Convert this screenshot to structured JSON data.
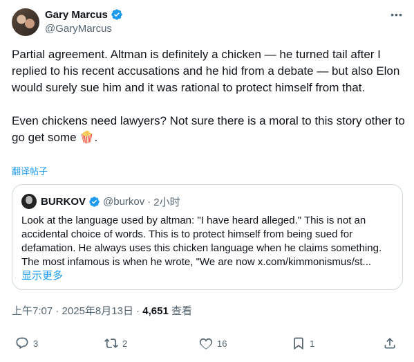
{
  "author": {
    "name": "Gary Marcus",
    "handle": "@GaryMarcus"
  },
  "tweet": {
    "text": "Partial agreement. Altman is definitely a chicken — he turned tail after I replied to his recent accusations and he hid from a debate — but also Elon would surely sue him and it was rational to protect himself from that.\n\nEven chickens need lawyers? Not sure there is a moral to this story other to go get some 🍿.",
    "translate_label": "翻译帖子"
  },
  "quote": {
    "name": "BURKOV",
    "handle": "@burkov",
    "separator": "·",
    "time": "2小时",
    "text": "Look at the language used by altman: \"I have heard alleged.\" This is not an accidental choice of words. This is to protect himself from being sued for defamation. He always uses this chicken language when he claims something. The most infamous is when he wrote, \"We are now x.com/kimmonismus/st...",
    "show_more": "显示更多"
  },
  "meta": {
    "time": "上午7:07",
    "separator": "·",
    "date": "2025年8月13日",
    "views_count": "4,651",
    "views_label": "查看"
  },
  "actions": {
    "replies": "3",
    "reposts": "2",
    "likes": "16",
    "bookmarks": "1"
  },
  "colors": {
    "accent": "#1d9bf0",
    "text": "#0f1419",
    "muted": "#536471",
    "border": "#cfd9de"
  },
  "icons": [
    "verified-badge-icon",
    "more-icon",
    "reply-icon",
    "repost-icon",
    "like-icon",
    "bookmark-icon",
    "share-icon"
  ]
}
